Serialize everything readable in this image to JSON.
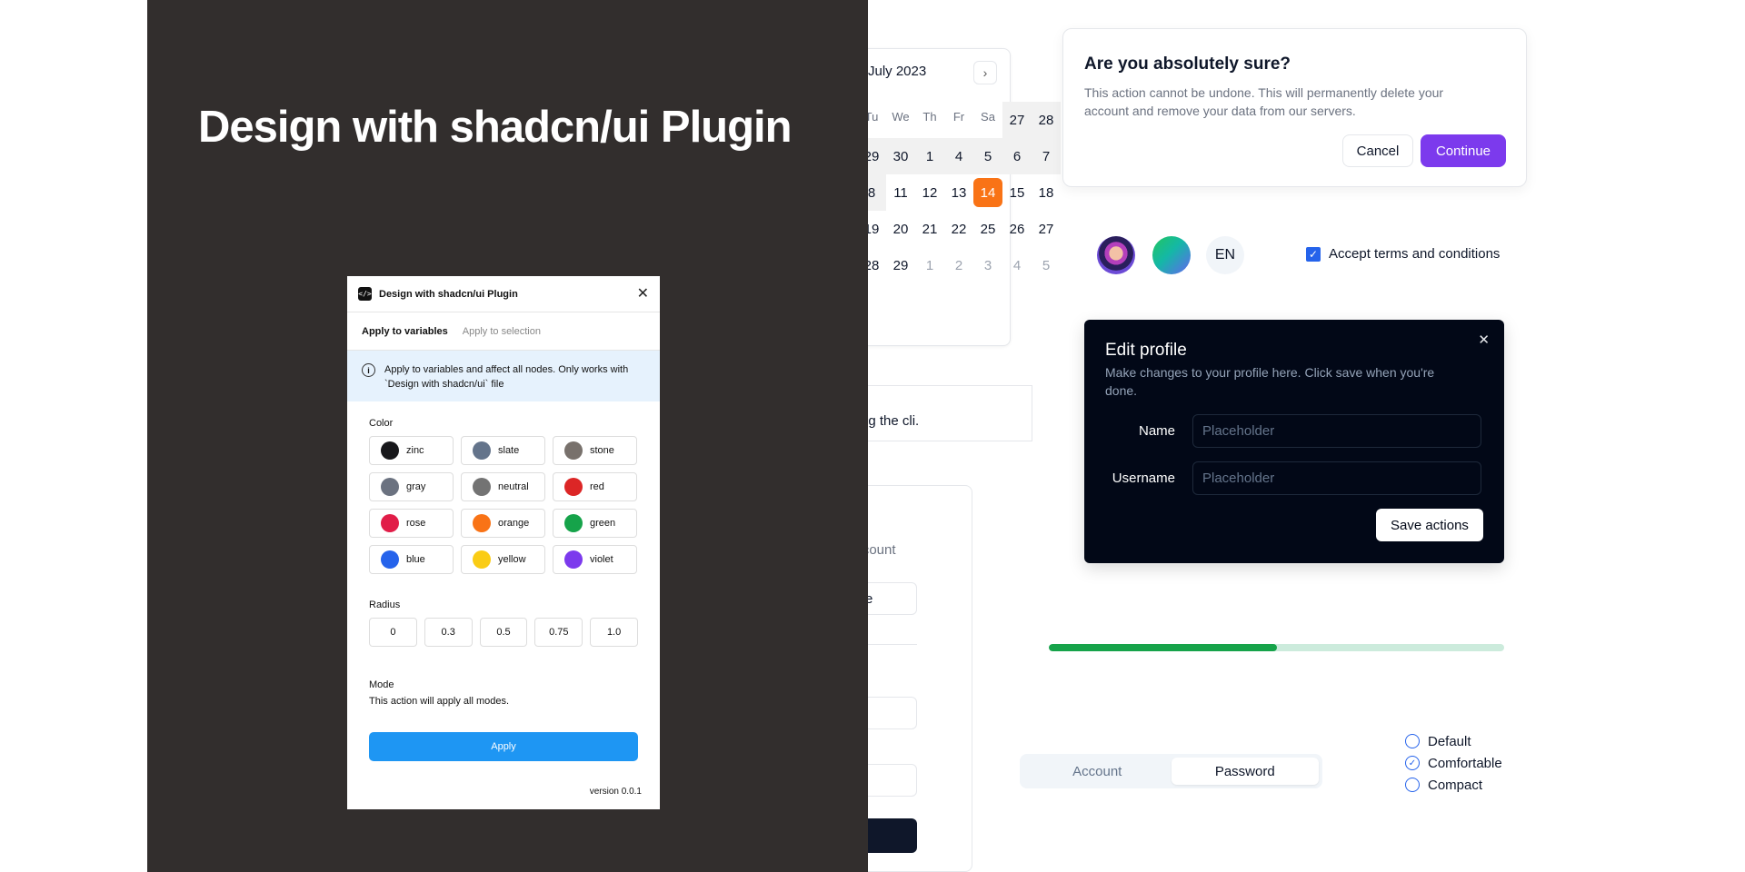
{
  "hero": {
    "title": "Design with shadcn/ui Plugin"
  },
  "plugin": {
    "logo": "</>",
    "title": "Design with shadcn/ui Plugin",
    "close": "✕",
    "tabs": [
      {
        "label": "Apply to variables"
      },
      {
        "label": "Apply to selection"
      }
    ],
    "info": "Apply to variables and affect all nodes. Only works with `Design with shadcn/ui` file",
    "info_icon": "i",
    "color_label": "Color",
    "colors": [
      {
        "name": "zinc",
        "hex": "#18181b"
      },
      {
        "name": "slate",
        "hex": "#64748b"
      },
      {
        "name": "stone",
        "hex": "#78716c"
      },
      {
        "name": "gray",
        "hex": "#6b7280"
      },
      {
        "name": "neutral",
        "hex": "#737373"
      },
      {
        "name": "red",
        "hex": "#dc2626"
      },
      {
        "name": "rose",
        "hex": "#e11d48"
      },
      {
        "name": "orange",
        "hex": "#f97316"
      },
      {
        "name": "green",
        "hex": "#16a34a"
      },
      {
        "name": "blue",
        "hex": "#2563eb"
      },
      {
        "name": "yellow",
        "hex": "#facc15"
      },
      {
        "name": "violet",
        "hex": "#7c3aed"
      }
    ],
    "radius_label": "Radius",
    "radii": [
      "0",
      "0.3",
      "0.5",
      "0.75",
      "1.0"
    ],
    "mode_label": "Mode",
    "mode_desc": "This action will apply all modes.",
    "apply": "Apply",
    "version": "version 0.0.1"
  },
  "calendar": {
    "title": "July 2023",
    "next_icon": "›",
    "day_headers": [
      "Tu",
      "We",
      "Th",
      "Fr",
      "Sa"
    ],
    "weeks": [
      [
        "27",
        "28",
        "29",
        "30",
        "1"
      ],
      [
        "4",
        "5",
        "6",
        "7",
        "8"
      ],
      [
        "11",
        "12",
        "13",
        "14",
        "15"
      ],
      [
        "18",
        "19",
        "20",
        "21",
        "22"
      ],
      [
        "25",
        "26",
        "27",
        "28",
        "29"
      ],
      [
        "1",
        "2",
        "3",
        "4",
        "5"
      ]
    ],
    "selected": "14"
  },
  "cli_card": {
    "text": "ng the cli."
  },
  "account_card": {
    "subtitle": "account",
    "google": "Google"
  },
  "alert": {
    "title": "Are you absolutely sure?",
    "desc": "This action cannot be undone. This will permanently delete your account and remove your data from our servers.",
    "cancel": "Cancel",
    "continue": "Continue"
  },
  "avatars": {
    "initials": "EN"
  },
  "terms": {
    "label": "Accept terms and conditions",
    "check": "✓"
  },
  "edit_profile": {
    "title": "Edit profile",
    "close": "✕",
    "desc": "Make changes to your profile here. Click save when you're done.",
    "name_label": "Name",
    "name_placeholder": "Placeholder",
    "username_label": "Username",
    "username_placeholder": "Placeholder",
    "save": "Save actions"
  },
  "progress": {
    "value": 0.5
  },
  "tabs": {
    "account": "Account",
    "password": "Password"
  },
  "radio": {
    "options": [
      "Default",
      "Comfortable",
      "Compact"
    ],
    "selected": "Comfortable",
    "check": "✓"
  },
  "colors": {
    "accent": "#7c3aed",
    "apply_blue": "#1e96f3",
    "selected_day": "#f97316",
    "progress": "#16a34a"
  }
}
